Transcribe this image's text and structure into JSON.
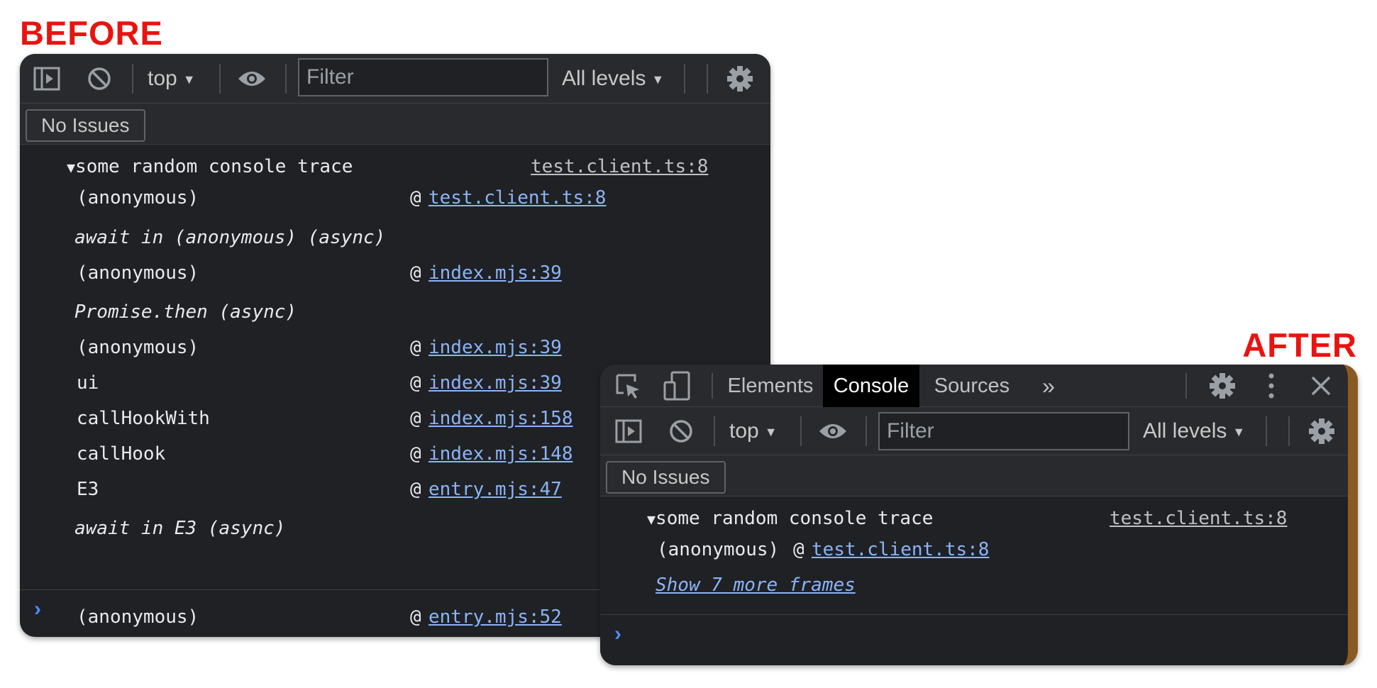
{
  "labels": {
    "before": "BEFORE",
    "after": "AFTER"
  },
  "colors": {
    "label_red": "#e8140f",
    "panel_bg": "#202124",
    "toolbar_bg": "#292a2d",
    "link_blue": "#8ab4f8",
    "prompt_blue": "#4a8af4",
    "active_tab_bg": "#000000"
  },
  "before": {
    "toolbar": {
      "sidebar_icon": "sidebar-toggle-icon",
      "clear_icon": "clear-console-icon",
      "context": "top",
      "eye_icon": "live-expression-icon",
      "filter_placeholder": "Filter",
      "levels": "All levels",
      "settings_icon": "gear-icon"
    },
    "issues": "No Issues",
    "trace": {
      "title": "some random console trace",
      "source": "test.client.ts:8",
      "frames": [
        {
          "fn": "(anonymous)",
          "at": "@",
          "link": "test.client.ts:8"
        },
        {
          "async": "await in (anonymous) (async)"
        },
        {
          "fn": "(anonymous)",
          "at": "@",
          "link": "index.mjs:39"
        },
        {
          "async": "Promise.then (async)"
        },
        {
          "fn": "(anonymous)",
          "at": "@",
          "link": "index.mjs:39"
        },
        {
          "fn": "ui",
          "at": "@",
          "link": "index.mjs:39"
        },
        {
          "fn": "callHookWith",
          "at": "@",
          "link": "index.mjs:158"
        },
        {
          "fn": "callHook",
          "at": "@",
          "link": "index.mjs:148"
        },
        {
          "fn": "E3",
          "at": "@",
          "link": "entry.mjs:47"
        },
        {
          "async": "await in E3 (async)"
        },
        {
          "fn": "(anonymous)",
          "at": "@",
          "link": "entry.mjs:52"
        }
      ]
    },
    "prompt": "›"
  },
  "after": {
    "tabs": {
      "inspect_icon": "inspect-element-icon",
      "device_icon": "device-toolbar-icon",
      "items": [
        "Elements",
        "Console",
        "Sources"
      ],
      "active": "Console",
      "more": "»",
      "settings_icon": "gear-icon",
      "menu_icon": "kebab-menu-icon",
      "close_icon": "close-icon"
    },
    "toolbar": {
      "context": "top",
      "filter_placeholder": "Filter",
      "levels": "All levels"
    },
    "issues": "No Issues",
    "trace": {
      "title": "some random console trace",
      "source": "test.client.ts:8",
      "frame_fn": "(anonymous)",
      "frame_at": "@",
      "frame_link": "test.client.ts:8",
      "show_more": "Show 7 more frames"
    },
    "prompt": "›"
  }
}
